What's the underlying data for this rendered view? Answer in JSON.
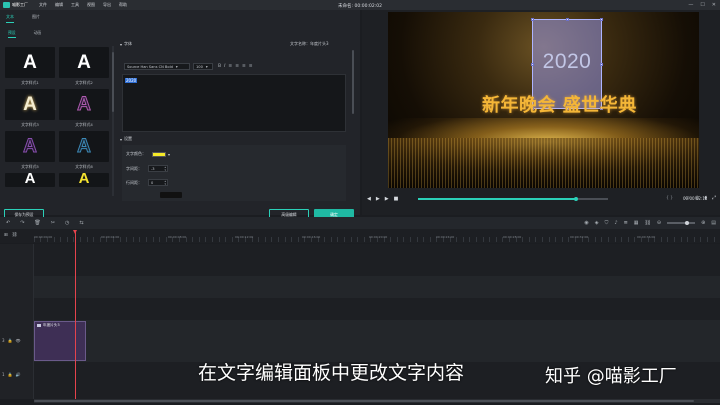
{
  "app": {
    "logo_text": "喵影工厂",
    "menu": [
      "文件",
      "编辑",
      "工具",
      "视图",
      "导出",
      "帮助"
    ],
    "project_title": "未命名: 00:00:02:02",
    "window_controls": [
      "—",
      "☐",
      "✕"
    ]
  },
  "editor": {
    "tabs": [
      "文本",
      "图片"
    ],
    "subtabs": [
      "预设",
      "动画"
    ],
    "text_name": "文字名称：年度片头3",
    "styles": [
      {
        "label": "文字样式1",
        "color": "#ffffff"
      },
      {
        "label": "文字样式2",
        "color": "#ffffff"
      },
      {
        "label": "文字样式3",
        "color": "#f3ecd0"
      },
      {
        "label": "文字样式4",
        "color": "#3a2a4a"
      },
      {
        "label": "文字样式5",
        "color": "#2a2036"
      },
      {
        "label": "文字样式6",
        "color": "#1e2a36"
      },
      {
        "label": "",
        "color": "#ffffff"
      },
      {
        "label": "",
        "color": "#f5e330"
      }
    ],
    "font_section": "字体",
    "font_name": "Source Han Sans CN Bold",
    "font_size": "100",
    "text_content": "2020",
    "settings_section": "设置",
    "color_label": "文字颜色：",
    "color_value": "#f5ea28",
    "spacing_label": "字间距：",
    "spacing_value": "-3",
    "line_label": "行间距：",
    "line_value": "0",
    "save_preset": "保存为预设",
    "advanced": "高级编辑",
    "ok": "确定"
  },
  "preview": {
    "year": "2020",
    "headline": "新年晚会 盛世华典",
    "timecode": "00:00:02:12",
    "brackets": "{ }",
    "progress": 0.83
  },
  "timeline": {
    "ruler_labels": [
      "00:00:00:00",
      "00:00:04:00",
      "00:00:08:00",
      "00:00:12:00",
      "00:00:16:00",
      "00:00:20:00",
      "00:00:24:00",
      "00:00:28:00",
      "00:00:32:00",
      "00:00:36:00",
      "00:00:40:00"
    ],
    "clip_label": "年度片头3",
    "track_a": "3",
    "track_b": "1"
  },
  "overlay": {
    "subtitle": "在文字编辑面板中更改文字内容",
    "watermark": "知乎 @喵影工厂"
  }
}
